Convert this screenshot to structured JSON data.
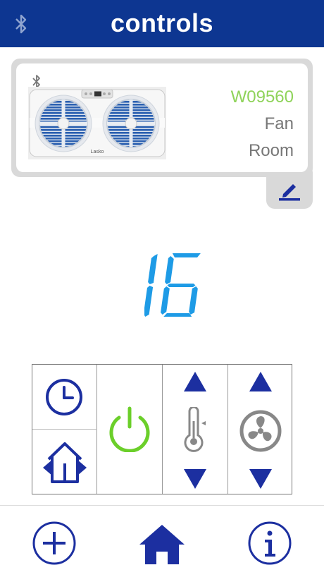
{
  "header": {
    "title": "controls",
    "bluetooth_icon": "bluetooth-icon"
  },
  "device": {
    "model": "W09560",
    "type": "Fan",
    "location": "Room",
    "brand_label": "Lasko",
    "edit_icon": "pencil-icon"
  },
  "display": {
    "value": "16"
  },
  "controls": {
    "timer_icon": "clock-icon",
    "mode_icon": "house-arrows-icon",
    "power_icon": "power-icon",
    "temperature_icon": "thermometer-icon",
    "fan_speed_icon": "fan-icon"
  },
  "tabbar": {
    "add_icon": "plus-circle-icon",
    "home_icon": "home-icon",
    "info_icon": "info-circle-icon"
  },
  "colors": {
    "header": "#0d3691",
    "accent_blue": "#1c2fa0",
    "display_blue": "#1e9be6",
    "power_green": "#6bcf2a",
    "model_green": "#8fd35a",
    "gray": "#777777"
  }
}
